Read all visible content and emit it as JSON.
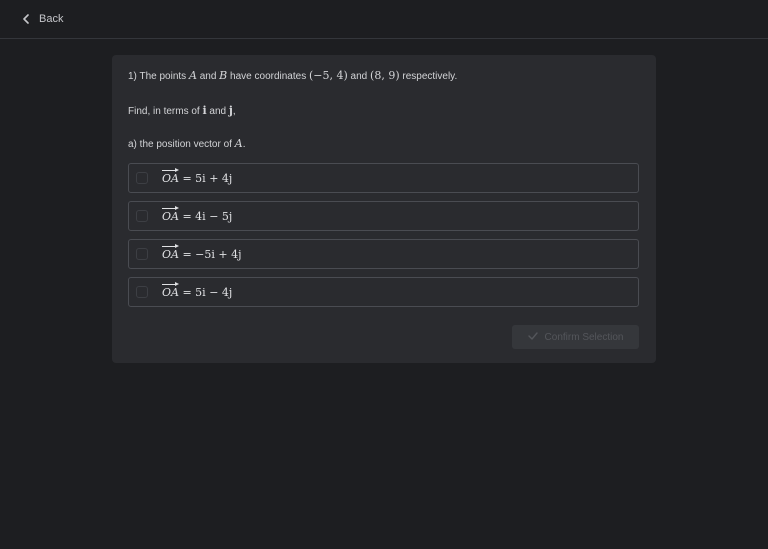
{
  "nav": {
    "back_label": "Back"
  },
  "question": {
    "line1_prefix": "1) The points ",
    "point_a": "A",
    "and1": " and ",
    "point_b": "B",
    "have_coords": " have coordinates ",
    "coord1": "(−5, 4)",
    "and2": " and ",
    "coord2": "(8, 9)",
    "line1_suffix": " respectively.",
    "line2_prefix": "Find, in terms of ",
    "i": "i",
    "and3": " and ",
    "j": "j",
    "line2_suffix": ",",
    "line3_prefix": "a) the position vector of ",
    "line3_var": "A",
    "line3_suffix": "."
  },
  "options": [
    {
      "vector": "OA",
      "expr": " = 5i + 4j"
    },
    {
      "vector": "OA",
      "expr": " = 4i − 5j"
    },
    {
      "vector": "OA",
      "expr": " = −5i + 4j"
    },
    {
      "vector": "OA",
      "expr": " = 5i − 4j"
    }
  ],
  "confirm_label": "Confirm Selection",
  "icons": {
    "back": "chevron-left-icon",
    "confirm": "check-icon"
  },
  "colors": {
    "background": "#1d1e21",
    "card": "#2a2b2f",
    "option_border": "#4a4c52",
    "disabled_button": "#35373b"
  }
}
